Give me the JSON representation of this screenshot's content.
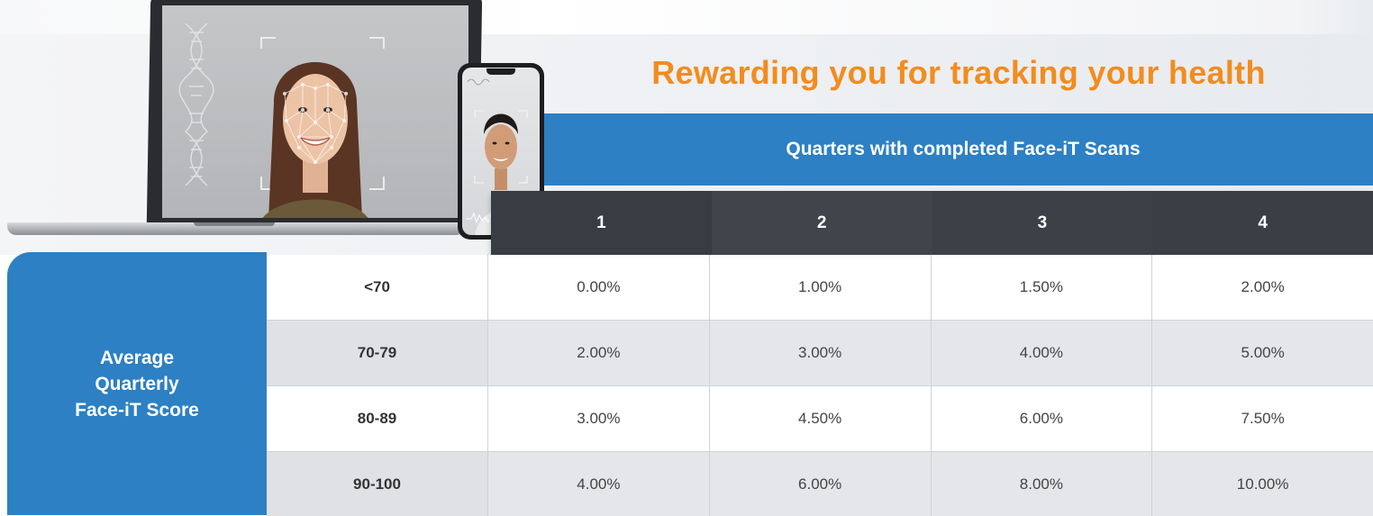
{
  "headline": "Rewarding you for tracking your health",
  "quarters_header": "Quarters with completed Face-iT Scans",
  "quarter_columns": [
    "1",
    "2",
    "3",
    "4"
  ],
  "score_label": "Average Quarterly Face-iT Score",
  "rows": [
    {
      "range": "<70",
      "values": [
        "0.00%",
        "1.00%",
        "1.50%",
        "2.00%"
      ]
    },
    {
      "range": "70-79",
      "values": [
        "2.00%",
        "3.00%",
        "4.00%",
        "5.00%"
      ]
    },
    {
      "range": "80-89",
      "values": [
        "3.00%",
        "4.50%",
        "6.00%",
        "7.50%"
      ]
    },
    {
      "range": "90-100",
      "values": [
        "4.00%",
        "6.00%",
        "8.00%",
        "10.00%"
      ]
    }
  ],
  "colors": {
    "headline_orange": "#f28c1e",
    "header_blue": "#2d80c3",
    "column_header_dark": "#383d43",
    "row_alt_grey": "#e4e6e9"
  }
}
